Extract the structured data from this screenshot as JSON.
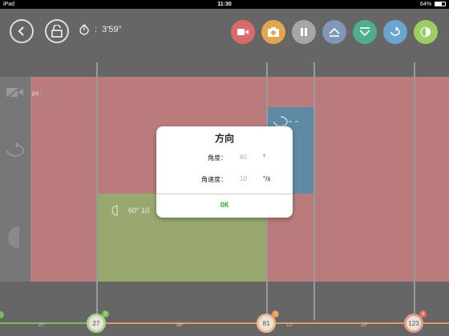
{
  "statusbar": {
    "device": "iPad",
    "time": "11:30",
    "battery": "64%"
  },
  "toolbar": {
    "timer": "3'59\"",
    "buttons": [
      {
        "name": "video-record-button",
        "icon": "video-camera-icon",
        "color": "#d96a6a"
      },
      {
        "name": "photo-button",
        "icon": "camera-icon",
        "color": "#e3a74e"
      },
      {
        "name": "pause-button",
        "icon": "pause-icon",
        "color": "#a6a6a6"
      },
      {
        "name": "up-button",
        "icon": "triangle-up-icon",
        "color": "#7f98b8"
      },
      {
        "name": "down-button",
        "icon": "triangle-down-icon",
        "color": "#4fae8d"
      },
      {
        "name": "loop-button",
        "icon": "loop-icon",
        "color": "#6ba3d3"
      },
      {
        "name": "half-moon-button",
        "icon": "half-moon-icon",
        "color": "#9ccc62"
      }
    ]
  },
  "tracks": {
    "ps_label": "ps :",
    "green_block_label": "60°   10"
  },
  "axis": {
    "ticks": [
      "27°",
      "34°",
      "12°",
      "25°"
    ],
    "nodes": [
      {
        "label": "27",
        "badge": "2"
      },
      {
        "label": "81",
        "badge": "3"
      },
      {
        "label": "123",
        "badge": "4"
      }
    ]
  },
  "dialog": {
    "title": "方向",
    "angle_label": "角度：",
    "angle_value": "60",
    "angle_unit": "°",
    "speed_label": "角速度：",
    "speed_value": "10",
    "speed_unit": "°/s",
    "ok_label": "OK"
  }
}
